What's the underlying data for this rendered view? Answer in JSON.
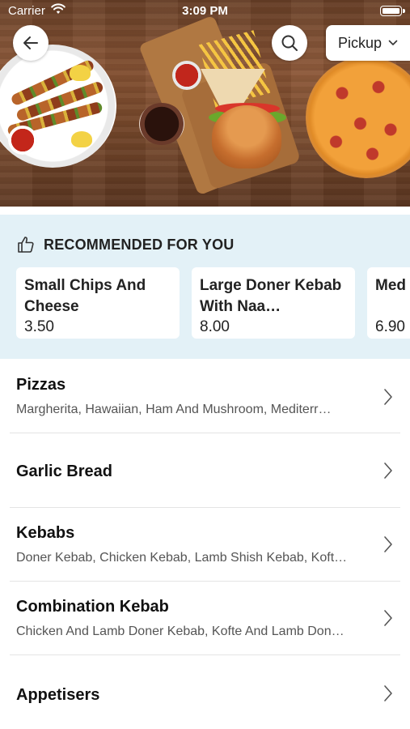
{
  "status_bar": {
    "carrier": "Carrier",
    "time": "3:09 PM"
  },
  "header": {
    "pickup_label": "Pickup",
    "back_icon": "arrow-left-icon",
    "search_icon": "search-icon",
    "dropdown_icon": "chevron-down-icon"
  },
  "recommended": {
    "title": "RECOMMENDED FOR YOU",
    "icon": "thumbs-up-icon",
    "items": [
      {
        "name": "Small Chips And Cheese",
        "price": "3.50"
      },
      {
        "name": "Large Doner Kebab With Naa…",
        "price": "8.00"
      },
      {
        "name": "Med Keba",
        "price": "6.90"
      }
    ]
  },
  "menu": {
    "categories": [
      {
        "title": "Pizzas",
        "subtitle": "Margherita, Hawaiian, Ham And Mushroom, Mediterr…"
      },
      {
        "title": "Garlic Bread",
        "subtitle": ""
      },
      {
        "title": "Kebabs",
        "subtitle": "Doner Kebab, Chicken Kebab, Lamb Shish Kebab, Koft…"
      },
      {
        "title": "Combination Kebab",
        "subtitle": "Chicken And Lamb Doner Kebab, Kofte And Lamb Don…"
      },
      {
        "title": "Appetisers",
        "subtitle": ""
      }
    ]
  },
  "colors": {
    "recommended_bg": "#e3f1f7",
    "card_bg": "#ffffff",
    "text_primary": "#111111",
    "text_secondary": "#555555"
  }
}
